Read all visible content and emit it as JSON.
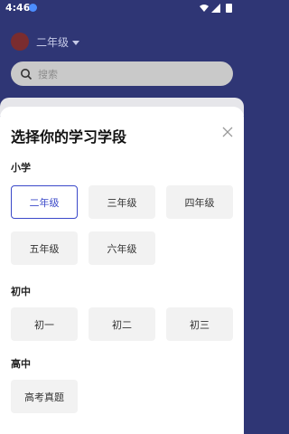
{
  "status_bar": {
    "time": "4:46"
  },
  "header": {
    "grade": "二年级",
    "search_placeholder": "搜索"
  },
  "sheet": {
    "title": "选择你的学习学段",
    "sections": [
      {
        "label": "小学",
        "items": [
          "二年级",
          "三年级",
          "四年级",
          "五年级",
          "六年级"
        ],
        "selected": "二年级"
      },
      {
        "label": "初中",
        "items": [
          "初一",
          "初二",
          "初三"
        ]
      },
      {
        "label": "高中",
        "items": [
          "高考真题"
        ]
      }
    ]
  },
  "colors": {
    "header_bg": "#2f3675",
    "accent": "#3b49c9",
    "button_bg": "#f2f2f2"
  }
}
